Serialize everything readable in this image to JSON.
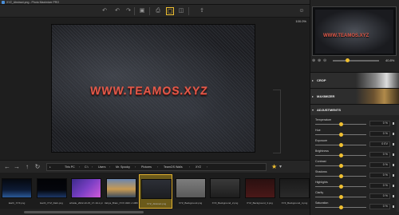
{
  "window": {
    "title": "XYZ_Abstract.png - Photo Maximizer PRO"
  },
  "toolbar": {
    "icons": [
      "undo-icon",
      "undo-icon",
      "redo-icon",
      "redo-icon",
      "save-icon",
      "print-icon",
      "single-view-icon",
      "split-view-icon",
      "share-icon",
      "user-icon"
    ]
  },
  "workspace": {
    "zoom": "100.0%"
  },
  "image": {
    "watermark": "WWW.TEAMOS.XYZ"
  },
  "navigator": {
    "zoom": "40.8%",
    "watermark": "WWW.TEAMOS.XYZ"
  },
  "path": {
    "crumbs": [
      "This PC",
      "C:\\",
      "Users",
      "Mr. Spooky",
      "Pictures",
      "TeamOS Walls",
      "XYZ"
    ]
  },
  "filmstrip": [
    {
      "label": "Earth_XYZ.png",
      "bg": "linear-gradient(180deg,#05080f,#0d1b35 60%,#2b5a9a)"
    },
    {
      "label": "Earth_XYZ_Dark.png",
      "bg": "linear-gradient(180deg,#020306,#04060c 60%,#1d3868)"
    },
    {
      "label": "whistle_2022-10-15_17-19-1.png",
      "bg": "linear-gradient(135deg,#3b2a8a,#7a3fc4 50%,#d05ad8)"
    },
    {
      "label": "Rahya_Brain_XYZ 1920 x 1080.png",
      "bg": "linear-gradient(180deg,#6a86b0,#c89a52 55%,#3a4a5e)"
    },
    {
      "label": "XYZ_Abstract.png",
      "bg": "linear-gradient(180deg,#2c2f36,#1c1d21)"
    },
    {
      "label": "XYZ_Background.png",
      "bg": "linear-gradient(180deg,#7d7d7d,#5a5a5a)"
    },
    {
      "label": "XYZ_Background_2.png",
      "bg": "linear-gradient(180deg,#3a3a3a,#1e1e1e)"
    },
    {
      "label": "XYZ_Background_3.png",
      "bg": "linear-gradient(180deg,#2a1010,#4a1818)"
    },
    {
      "label": "XYZ_Background_4.png",
      "bg": "linear-gradient(180deg,#1a1a1a,#2a2a2a)"
    }
  ],
  "panel": {
    "crop": "CROP",
    "maximizer": "MAXIMIZER",
    "adjustments": "ADJUSTMENTS",
    "rows": [
      {
        "name": "Temperature",
        "value": "0 %"
      },
      {
        "name": "Hue",
        "value": "0 %"
      },
      {
        "name": "Exposure",
        "value": "0 EV"
      },
      {
        "name": "Brightness",
        "value": "0 %"
      },
      {
        "name": "Contrast",
        "value": "0 %"
      },
      {
        "name": "Shadows",
        "value": "0 %"
      },
      {
        "name": "Highlights",
        "value": "0 %"
      },
      {
        "name": "Clarity",
        "value": "0 %"
      },
      {
        "name": "Saturation",
        "value": "0 %"
      }
    ]
  },
  "colors": {
    "accent": "#f0c030",
    "watermark": "#e25a4a"
  }
}
